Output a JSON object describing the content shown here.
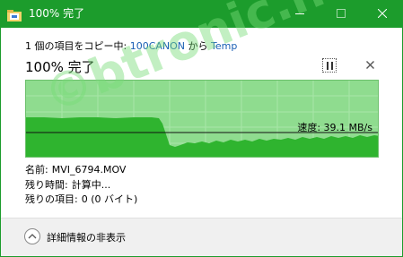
{
  "window": {
    "title": "100% 完了",
    "accent_color": "#1c9c2c",
    "icons": {
      "app": "copy-folder-icon",
      "minimize": "minimize-icon",
      "maximize": "maximize-icon",
      "close": "close-icon"
    }
  },
  "copy": {
    "prefix": "1 個の項目をコピー中: ",
    "source": "100CANON",
    "connector": " から ",
    "destination": "Temp"
  },
  "progress": {
    "heading": "100% 完了",
    "percent": 100,
    "pause_icon": "pause-icon",
    "cancel_icon": "cancel-icon"
  },
  "graph": {
    "speed_label": "速度: 39.1 MB/s",
    "fill_color": "#8fdc8f",
    "area_color": "#2fb42f"
  },
  "details": {
    "name_label": "名前:",
    "name_value": "MVI_6794.MOV",
    "time_label": "残り時間:",
    "time_value": "計算中...",
    "items_label": "残りの項目:",
    "items_value": "0 (0 バイト)"
  },
  "footer": {
    "toggle_label": "詳細情報の非表示",
    "toggle_icon": "chevron-up-icon"
  },
  "watermark": "©btronic.net"
}
